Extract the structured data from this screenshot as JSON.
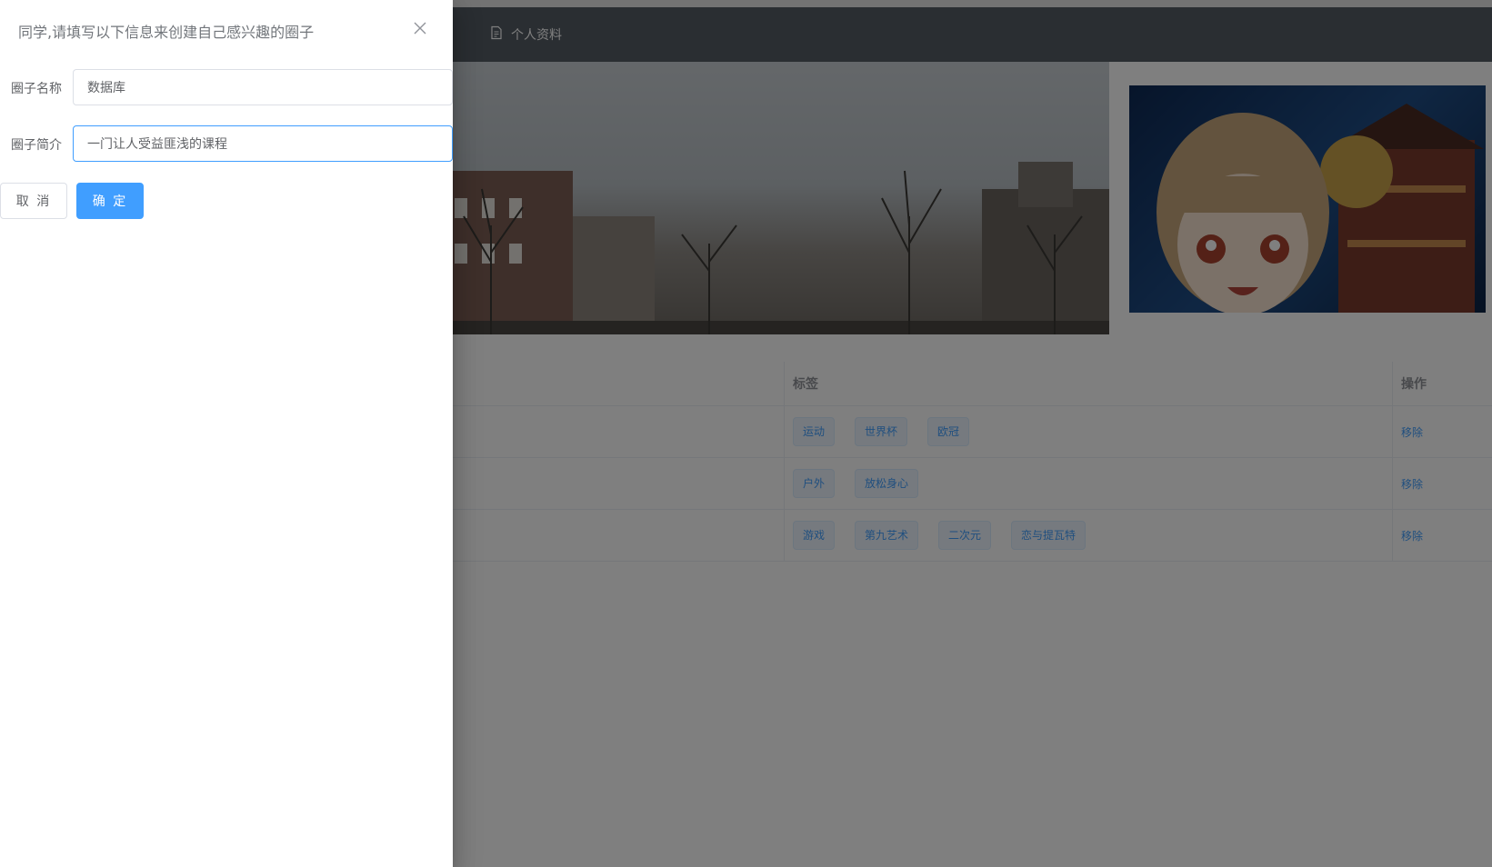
{
  "nav": {
    "profile_label": "个人资料"
  },
  "carousel": {
    "slides": 3,
    "active_index": 0
  },
  "table": {
    "headers": {
      "tags": "标签",
      "actions": "操作"
    },
    "rows": [
      {
        "tags": [
          "运动",
          "世界杯",
          "欧冠"
        ],
        "action": "移除"
      },
      {
        "tags": [
          "户外",
          "放松身心"
        ],
        "action": "移除"
      },
      {
        "tags": [
          "游戏",
          "第九艺术",
          "二次元",
          "恋与提瓦特"
        ],
        "action": "移除"
      }
    ]
  },
  "drawer": {
    "title": "同学,请填写以下信息来创建自己感兴趣的圈子",
    "name_label": "圈子名称",
    "name_value": "数据库",
    "intro_label": "圈子简介",
    "intro_value": "一门让人受益匪浅的课程",
    "cancel_label": "取 消",
    "confirm_label": "确 定"
  },
  "colors": {
    "primary": "#409eff",
    "navbar": "#545c64",
    "overlay": "rgba(0,0,0,0.5)"
  }
}
